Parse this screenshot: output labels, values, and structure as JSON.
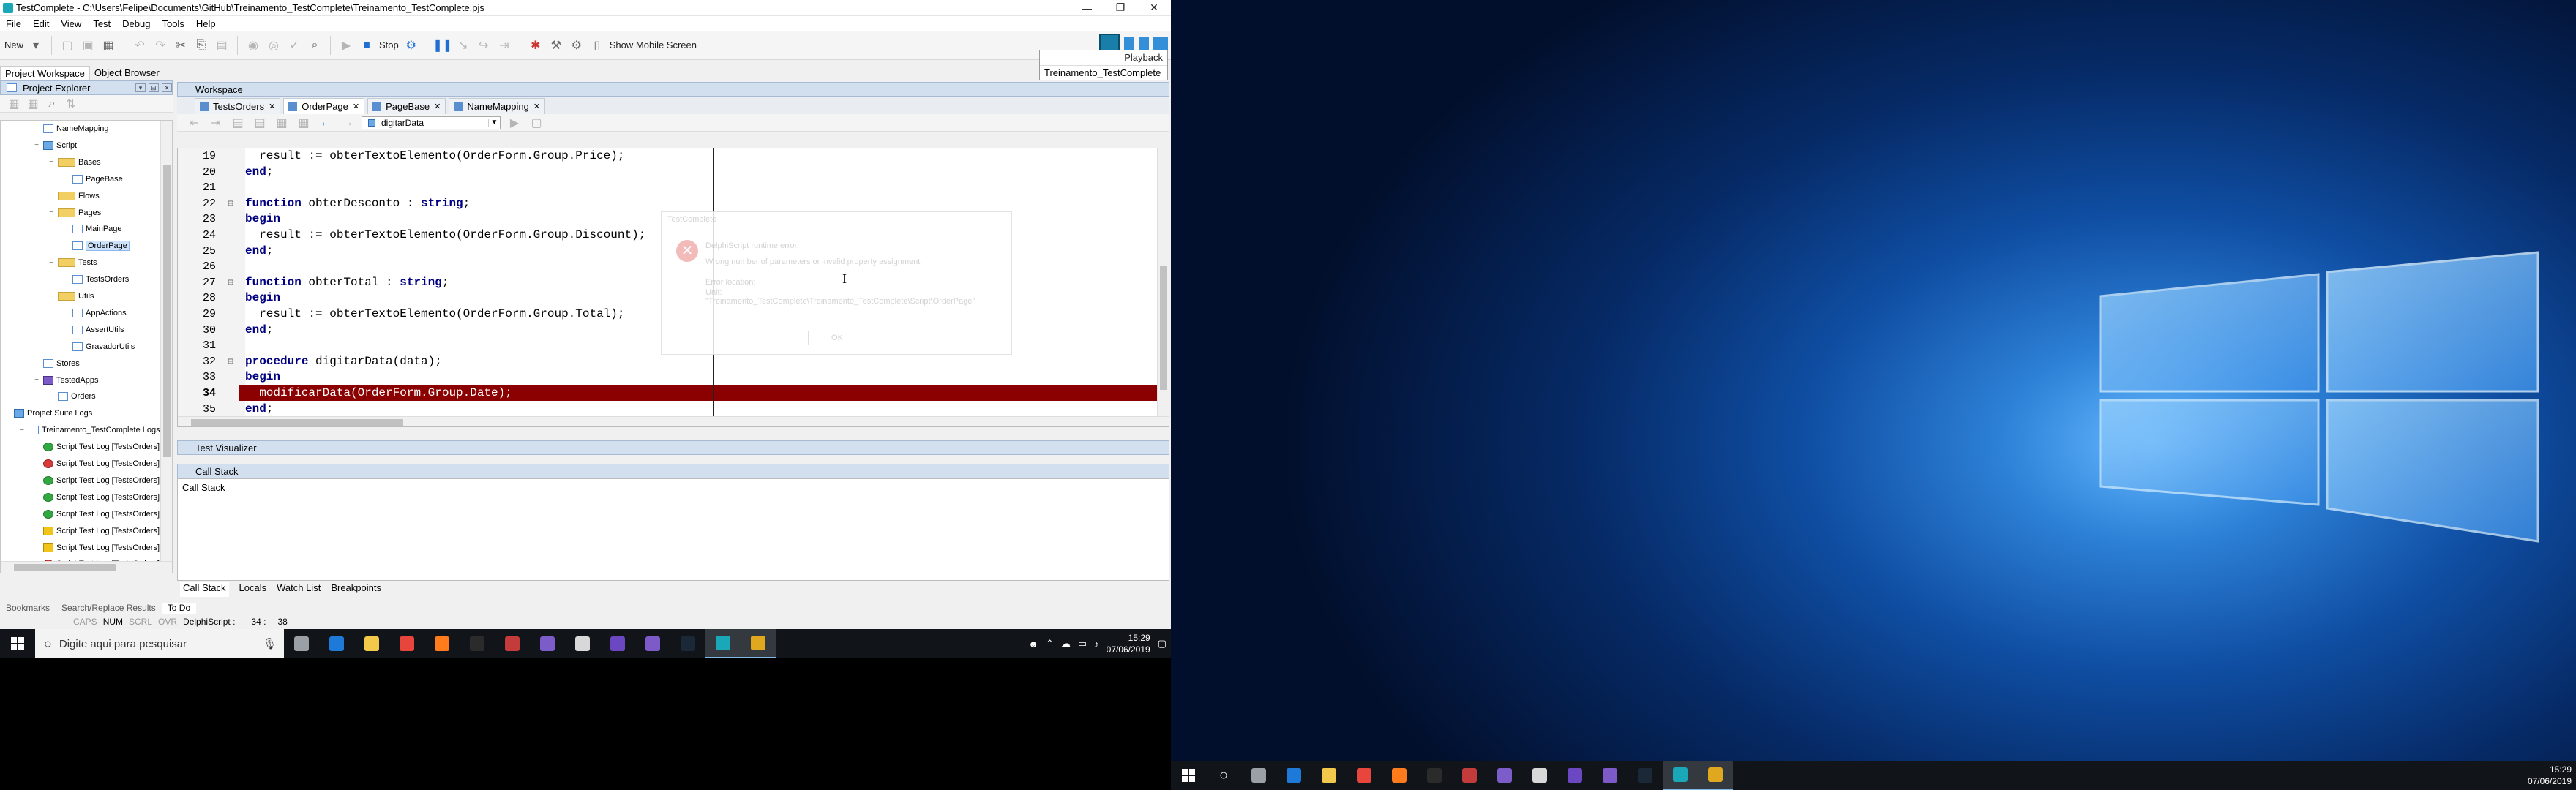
{
  "app": {
    "title": "TestComplete - C:\\Users\\Felipe\\Documents\\GitHub\\Treinamento_TestComplete\\Treinamento_TestComplete.pjs",
    "window_controls": [
      "—",
      "❐",
      "✕"
    ],
    "menu": [
      "File",
      "Edit",
      "View",
      "Test",
      "Debug",
      "Tools",
      "Help"
    ],
    "toolbar": {
      "new_label": "New",
      "stop_label": "Stop",
      "mobile_label": "Show Mobile Screen"
    },
    "playback": {
      "label": "Playback",
      "project": "Treinamento_TestComplete"
    }
  },
  "sidebar": {
    "tabs": [
      "Project Workspace",
      "Object Browser"
    ],
    "panel_title": "Project Explorer",
    "tree": [
      {
        "label": "NameMapping",
        "indent": 2,
        "icon": "file"
      },
      {
        "label": "Script",
        "indent": 2,
        "icon": "scr",
        "expand": "−"
      },
      {
        "label": "Bases",
        "indent": 3,
        "icon": "fold",
        "expand": "−"
      },
      {
        "label": "PageBase",
        "indent": 4,
        "icon": "file"
      },
      {
        "label": "Flows",
        "indent": 3,
        "icon": "fold"
      },
      {
        "label": "Pages",
        "indent": 3,
        "icon": "fold",
        "expand": "−"
      },
      {
        "label": "MainPage",
        "indent": 4,
        "icon": "file"
      },
      {
        "label": "OrderPage",
        "indent": 4,
        "icon": "file",
        "selected": true
      },
      {
        "label": "Tests",
        "indent": 3,
        "icon": "fold",
        "expand": "−"
      },
      {
        "label": "TestsOrders",
        "indent": 4,
        "icon": "file"
      },
      {
        "label": "Utils",
        "indent": 3,
        "icon": "fold",
        "expand": "−"
      },
      {
        "label": "AppActions",
        "indent": 4,
        "icon": "file"
      },
      {
        "label": "AssertUtils",
        "indent": 4,
        "icon": "file"
      },
      {
        "label": "GravadorUtils",
        "indent": 4,
        "icon": "file"
      },
      {
        "label": "Stores",
        "indent": 2,
        "icon": "file"
      },
      {
        "label": "TestedApps",
        "indent": 2,
        "icon": "app",
        "expand": "−"
      },
      {
        "label": "Orders",
        "indent": 3,
        "icon": "file"
      },
      {
        "label": "Project Suite Logs",
        "indent": 0,
        "icon": "scr",
        "expand": "−"
      },
      {
        "label": "Treinamento_TestComplete Logs",
        "indent": 1,
        "icon": "file",
        "expand": "−"
      },
      {
        "label": "Script Test Log [TestsOrders]",
        "indent": 2,
        "icon": "pass"
      },
      {
        "label": "Script Test Log [TestsOrders]",
        "indent": 2,
        "icon": "fail"
      },
      {
        "label": "Script Test Log [TestsOrders]",
        "indent": 2,
        "icon": "pass"
      },
      {
        "label": "Script Test Log [TestsOrders]",
        "indent": 2,
        "icon": "pass"
      },
      {
        "label": "Script Test Log [TestsOrders]",
        "indent": 2,
        "icon": "pass"
      },
      {
        "label": "Script Test Log [TestsOrders]",
        "indent": 2,
        "icon": "warn"
      },
      {
        "label": "Script Test Log [TestsOrders]",
        "indent": 2,
        "icon": "warn"
      },
      {
        "label": "Script Test Log [TestsOrders]",
        "indent": 2,
        "icon": "fail"
      }
    ],
    "bottom_tabs": [
      "Bookmarks",
      "Search/Replace Results",
      "To Do"
    ]
  },
  "workspace": {
    "title": "Workspace",
    "tabs": [
      "TestsOrders",
      "OrderPage",
      "PageBase",
      "NameMapping"
    ],
    "active_tab": 1,
    "procedure": "digitarData",
    "code": [
      {
        "ln": "19",
        "text": "  result := obterTextoElemento(OrderForm.Group.Price);",
        "fold": ""
      },
      {
        "ln": "20",
        "text": "end;",
        "fold": ""
      },
      {
        "ln": "21",
        "text": "",
        "fold": ""
      },
      {
        "ln": "22",
        "text": "function obterDesconto : string;",
        "fold": "⊟"
      },
      {
        "ln": "23",
        "text": "begin",
        "fold": ""
      },
      {
        "ln": "24",
        "text": "  result := obterTextoElemento(OrderForm.Group.Discount);",
        "fold": ""
      },
      {
        "ln": "25",
        "text": "end;",
        "fold": ""
      },
      {
        "ln": "26",
        "text": "",
        "fold": ""
      },
      {
        "ln": "27",
        "text": "function obterTotal : string;",
        "fold": "⊟"
      },
      {
        "ln": "28",
        "text": "begin",
        "fold": ""
      },
      {
        "ln": "29",
        "text": "  result := obterTextoElemento(OrderForm.Group.Total);",
        "fold": ""
      },
      {
        "ln": "30",
        "text": "end;",
        "fold": ""
      },
      {
        "ln": "31",
        "text": "",
        "fold": ""
      },
      {
        "ln": "32",
        "text": "procedure digitarData(data);",
        "fold": "⊟"
      },
      {
        "ln": "33",
        "text": "begin",
        "fold": ""
      },
      {
        "ln": "34",
        "text": "  modificarData(OrderForm.Group.Date);",
        "fold": "",
        "error": true
      },
      {
        "ln": "35",
        "text": "end;",
        "fold": ""
      }
    ],
    "dialog": {
      "title": "TestComplete",
      "line1": "DelphiScript runtime error.",
      "line2": "Wrong number of parameters or invalid property assignment",
      "line3": "Error location:",
      "line4": "Unit:",
      "line5": "\"Treinamento_TestComplete\\Treinamento_TestComplete\\Script\\OrderPage\"",
      "ok": "OK"
    },
    "test_visualizer": "Test Visualizer",
    "call_stack_title": "Call Stack",
    "call_stack_body": "Call Stack",
    "debug_tabs": [
      "Call Stack",
      "Locals",
      "Watch List",
      "Breakpoints"
    ]
  },
  "status": {
    "caps": "CAPS",
    "num": "NUM",
    "scrl": "SCRL",
    "ovr": "OVR",
    "lang": "DelphiScript :",
    "line": "34 :",
    "col": "38"
  },
  "taskbar_left": {
    "search_placeholder": "Digite aqui para pesquisar",
    "time": "15:29",
    "date": "07/06/2019"
  },
  "taskbar_right": {
    "time": "15:29",
    "date": "07/06/2019"
  }
}
